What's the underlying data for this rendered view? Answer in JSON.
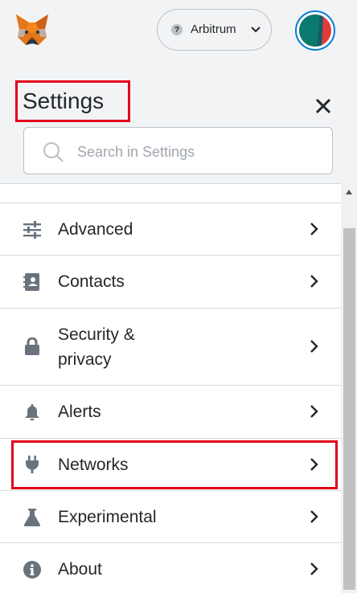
{
  "header": {
    "network_label": "Arbitrum",
    "network_badge": "?"
  },
  "settings": {
    "title": "Settings",
    "search_placeholder": "Search in Settings"
  },
  "menu": {
    "items": [
      {
        "label": "Advanced",
        "icon": "sliders-icon"
      },
      {
        "label": "Contacts",
        "icon": "contacts-book-icon"
      },
      {
        "label": "Security &",
        "label2": "privacy",
        "icon": "lock-icon"
      },
      {
        "label": "Alerts",
        "icon": "bell-icon"
      },
      {
        "label": "Networks",
        "icon": "plug-icon"
      },
      {
        "label": "Experimental",
        "icon": "flask-icon"
      },
      {
        "label": "About",
        "icon": "info-icon"
      }
    ]
  },
  "colors": {
    "highlight": "#e0001b",
    "accent": "#037dd6",
    "icon": "#6a737d"
  }
}
